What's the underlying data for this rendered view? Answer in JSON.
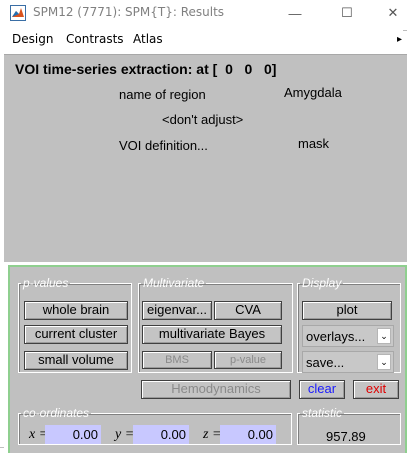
{
  "window": {
    "title": "SPM12 (7771): SPM{T}: Results",
    "minimize_glyph": "—",
    "maximize_glyph": "☐",
    "close_glyph": "✕"
  },
  "menu": {
    "items": [
      "Design",
      "Contrasts",
      "Atlas"
    ],
    "overflow_glyph": "▸"
  },
  "voi": {
    "heading": "VOI time-series extraction: at [  0   0   0]",
    "region_label": "name of region",
    "region_value": "Amygdala",
    "adjust_label": "<don't adjust>",
    "definition_label": "VOI definition...",
    "definition_value": "mask"
  },
  "pvalues": {
    "legend": "p-values",
    "buttons": [
      "whole brain",
      "current cluster",
      "small volume"
    ]
  },
  "multivariate": {
    "legend": "Multivariate",
    "eigenvariate": "eigenvar...",
    "cva": "CVA",
    "multivariate_bayes": "multivariate Bayes",
    "bms": "BMS",
    "pvalue": "p-value"
  },
  "display": {
    "legend": "Display",
    "plot": "plot",
    "overlays": "overlays...",
    "save": "save...",
    "dropdown_glyph": "⌄"
  },
  "actions": {
    "hemodynamics": "Hemodynamics",
    "clear": "clear",
    "exit": "exit",
    "clear_color": "#1a1aff",
    "exit_color": "#e00000"
  },
  "coordinates": {
    "legend": "co-ordinates",
    "x_label": "x =",
    "y_label": "y =",
    "z_label": "z =",
    "x": "0.00",
    "y": "0.00",
    "z": "0.00",
    "field_color": "#c8c8ff"
  },
  "statistic": {
    "legend": "statistic",
    "value": "957.89"
  },
  "colors": {
    "panel_bg": "#c0c0c0",
    "frame_border": "#8fcf8f"
  }
}
